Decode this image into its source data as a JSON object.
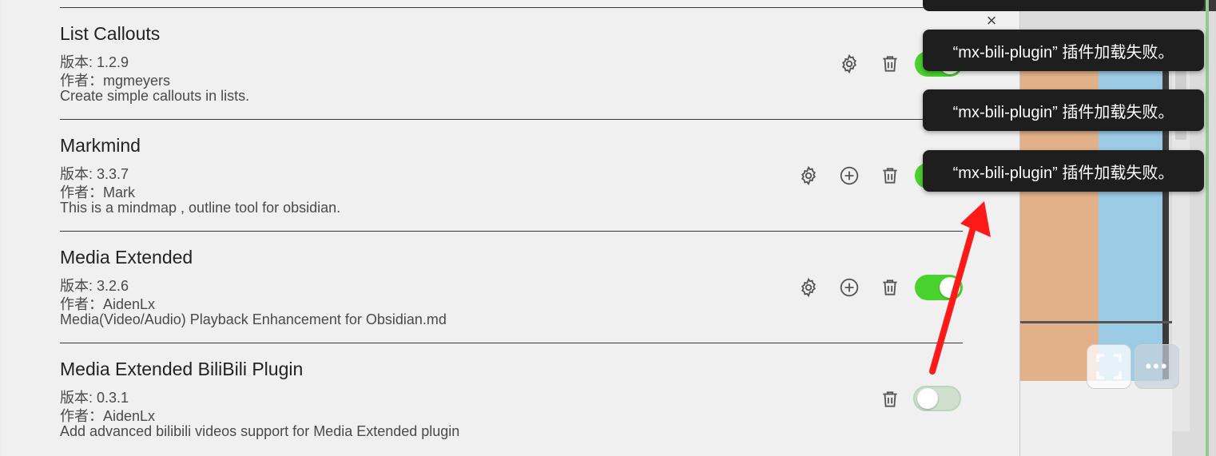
{
  "dialog": {
    "close_glyph": "×"
  },
  "plugins": [
    {
      "name": "List Callouts",
      "version": "版本: 1.2.9",
      "author": "作者：mgmeyers",
      "description": "Create simple callouts in lists.",
      "enabled": true,
      "controls": [
        "gear-icon",
        "trash-icon"
      ]
    },
    {
      "name": "Markmind",
      "version": "版本: 3.3.7",
      "author": "作者：Mark",
      "description": "This is a mindmap , outline tool for obsidian.",
      "enabled": true,
      "controls": [
        "gear-icon",
        "plus-circle-icon",
        "trash-icon"
      ]
    },
    {
      "name": "Media Extended",
      "version": "版本: 3.2.6",
      "author": "作者：AidenLx",
      "description": "Media(Video/Audio) Playback Enhancement for Obsidian.md",
      "enabled": true,
      "controls": [
        "gear-icon",
        "plus-circle-icon",
        "trash-icon"
      ]
    },
    {
      "name": "Media Extended BiliBili Plugin",
      "version": "版本: 0.3.1",
      "author": "作者：AidenLx",
      "description": "Add advanced bilibili videos support for Media Extended plugin",
      "enabled": false,
      "controls": [
        "trash-icon"
      ]
    }
  ],
  "notices": [
    {
      "text": "“mx-bili-plugin” 插件加载失败。"
    },
    {
      "text": "“mx-bili-plugin” 插件加载失败。"
    },
    {
      "text": "“mx-bili-plugin” 插件加载失败。"
    }
  ],
  "colors": {
    "toggle_on": "#49d12e",
    "notice_bg": "#1e1e1e",
    "arrow": "#ff1a1a"
  }
}
